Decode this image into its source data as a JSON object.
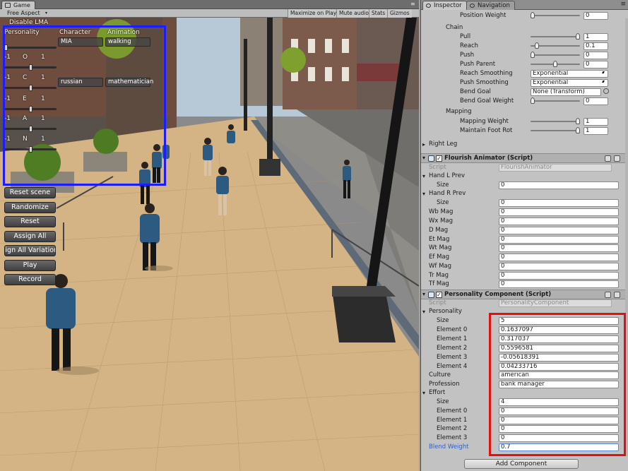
{
  "game_tab": {
    "label": "Game"
  },
  "game_toolbar": {
    "aspect": "Free Aspect",
    "buttons": [
      "Maximize on Play",
      "Mute audio",
      "Stats",
      "Gizmos"
    ]
  },
  "overlay": {
    "disable_label": "Disable LMA",
    "col_personality": "Personality",
    "col_character": "Character",
    "col_animation": "Animation",
    "character_value": "MIA",
    "animation_value": "walking",
    "culture_value": "russian",
    "profession_value": "mathematician",
    "rows": [
      {
        "min": "-1",
        "letter": "O",
        "max": "1",
        "level": 0.5
      },
      {
        "min": "-1",
        "letter": "C",
        "max": "1",
        "level": 0.5
      },
      {
        "min": "-1",
        "letter": "E",
        "max": "1",
        "level": 0.5
      },
      {
        "min": "-1",
        "letter": "A",
        "max": "1",
        "level": 0.5
      },
      {
        "min": "-1",
        "letter": "N",
        "max": "1",
        "level": 0.5
      }
    ],
    "buttons": [
      "Reset scene",
      "Randomize",
      "Reset",
      "Assign All",
      "Assign All Variations",
      "Play",
      "Record"
    ]
  },
  "inspector_tabs": {
    "inspector": "Inspector",
    "navigation": "Navigation"
  },
  "ik": {
    "position_weight_label": "Position Weight",
    "position_weight": "0",
    "position_weight_level": 0.0,
    "chain_label": "Chain",
    "pull_label": "Pull",
    "pull": "1",
    "pull_level": 1.0,
    "reach_label": "Reach",
    "reach": "0.1",
    "reach_level": 0.1,
    "push_label": "Push",
    "push": "0",
    "push_level": 0.0,
    "push_parent_label": "Push Parent",
    "push_parent": "0",
    "push_parent_level": 0.5,
    "reach_smoothing_label": "Reach Smoothing",
    "reach_smoothing": "Exponential",
    "push_smoothing_label": "Push Smoothing",
    "push_smoothing": "Exponential",
    "bend_goal_label": "Bend Goal",
    "bend_goal": "None (Transform)",
    "bend_goal_weight_label": "Bend Goal Weight",
    "bend_goal_weight": "0",
    "bend_goal_weight_level": 0.0,
    "mapping_label": "Mapping",
    "mapping_weight_label": "Mapping Weight",
    "mapping_weight": "1",
    "mapping_weight_level": 1.0,
    "maintain_rot_label": "Maintain Foot Rot",
    "maintain_rot": "1",
    "maintain_rot_level": 1.0,
    "right_leg_label": "Right Leg"
  },
  "flourish": {
    "title": "Flourish Animator (Script)",
    "script_label": "Script",
    "script_value": "FlourishAnimator",
    "hand_l_label": "Hand L Prev",
    "size_label": "Size",
    "hand_l_size": "0",
    "hand_r_label": "Hand R Prev",
    "hand_r_size": "0",
    "mags": [
      {
        "label": "Wb Mag",
        "value": "0"
      },
      {
        "label": "Wx Mag",
        "value": "0"
      },
      {
        "label": "D Mag",
        "value": "0"
      },
      {
        "label": "Et Mag",
        "value": "0"
      },
      {
        "label": "Wt Mag",
        "value": "0"
      },
      {
        "label": "Ef Mag",
        "value": "0"
      },
      {
        "label": "Wf Mag",
        "value": "0"
      },
      {
        "label": "Tr Mag",
        "value": "0"
      },
      {
        "label": "Tf Mag",
        "value": "0"
      }
    ]
  },
  "personality_component": {
    "title": "Personality Component (Script)",
    "script_label": "Script",
    "script_value": "PersonalityComponent",
    "personality_label": "Personality",
    "size_label": "Size",
    "size": "5",
    "elements": [
      {
        "label": "Element 0",
        "value": "0.1637097"
      },
      {
        "label": "Element 1",
        "value": "0.317037"
      },
      {
        "label": "Element 2",
        "value": "0.5596581"
      },
      {
        "label": "Element 3",
        "value": "-0.05618391"
      },
      {
        "label": "Element 4",
        "value": "0.04233716"
      }
    ],
    "culture_label": "Culture",
    "culture": "american",
    "profession_label": "Profession",
    "profession": "bank manager",
    "effort_label": "Effort",
    "effort_size": "4",
    "effort_elements": [
      {
        "label": "Element 0",
        "value": "0"
      },
      {
        "label": "Element 1",
        "value": "0"
      },
      {
        "label": "Element 2",
        "value": "0"
      },
      {
        "label": "Element 3",
        "value": "0"
      }
    ],
    "blend_weight_label": "Blend Weight",
    "blend_weight": "0.7"
  },
  "add_component": "Add Component",
  "colors": {
    "highlight_blue": "#1c1cff",
    "highlight_red": "#e01010",
    "blend_label": "#2f5fd0"
  }
}
